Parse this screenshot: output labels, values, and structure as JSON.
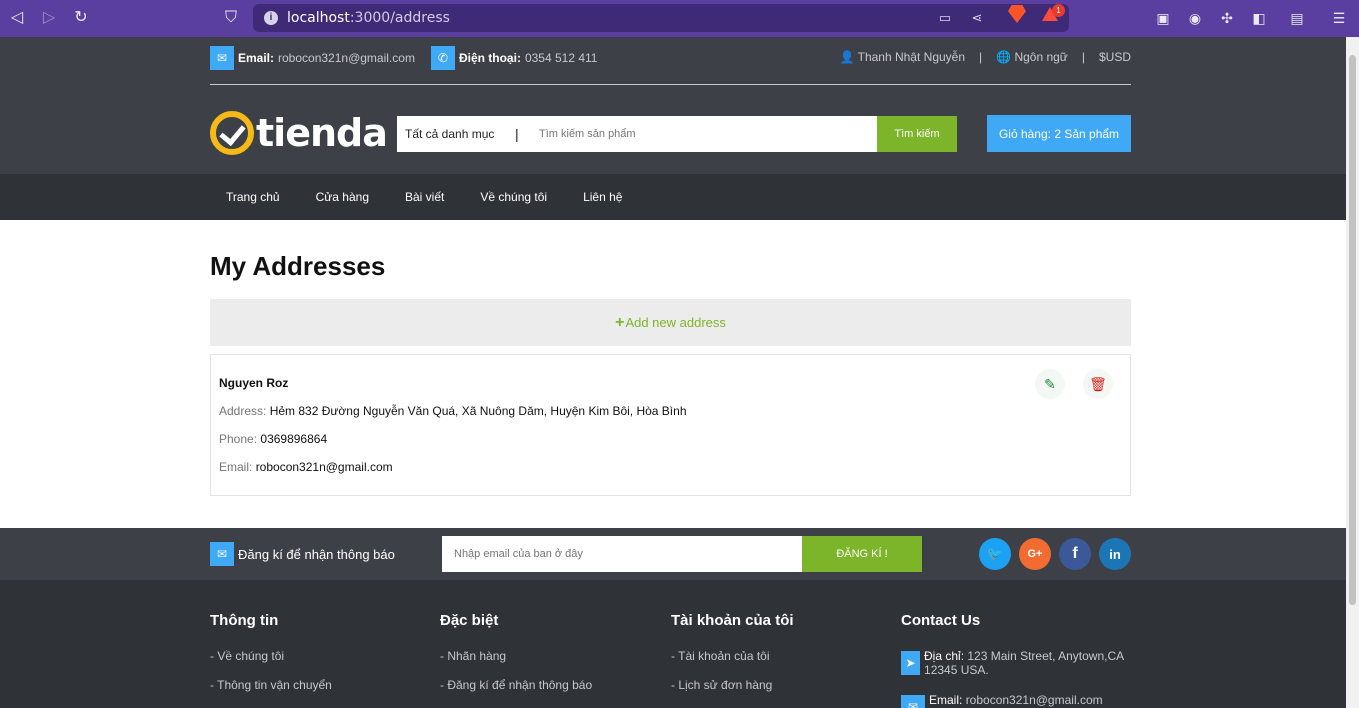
{
  "browser": {
    "url_host": "localhost",
    "url_path": ":3000/address",
    "rewards_badge": "1"
  },
  "topbar": {
    "email_label": "Email:",
    "email_value": "robocon321n@gmail.com",
    "phone_label": "Điện thoại:",
    "phone_value": "0354 512 411",
    "user_name": "Thanh Nhật Nguyễn",
    "language": "Ngôn ngữ",
    "currency": "USD",
    "separator": "|"
  },
  "logo": {
    "text": "tienda"
  },
  "search": {
    "category": "Tất cả danh mục",
    "divider": "|",
    "placeholder": "Tìm kiếm sản phẩm",
    "button": "Tìm kiếm"
  },
  "cart": {
    "label": "Giỏ hàng: 2 Sản phẩm"
  },
  "nav": {
    "items": [
      "Trang chủ",
      "Cửa hàng",
      "Bài viết",
      "Về chúng tôi",
      "Liên hệ"
    ]
  },
  "main": {
    "title": "My Addresses",
    "add_plus": "+",
    "add_label": "Add new address",
    "addresses": [
      {
        "name": "Nguyen Roz",
        "address_label": "Address:",
        "address": "Hẻm 832 Đường Nguyễn Văn Quá, Xã Nuông Dăm, Huyện Kim Bôi, Hòa Bình",
        "phone_label": "Phone:",
        "phone": "0369896864",
        "email_label": "Email:",
        "email": "robocon321n@gmail.com"
      }
    ]
  },
  "subscribe": {
    "label": "Đăng kí để nhận thông báo",
    "placeholder": "Nhập email của ban ở đây",
    "button": "ĐĂNG KÍ !",
    "social": {
      "gplus": "G+",
      "facebook": "f",
      "linkedin": "in"
    }
  },
  "footer": {
    "info": {
      "title": "Thông tin",
      "links": [
        "- Về chúng tôi",
        "- Thông tin vận chuyển"
      ]
    },
    "special": {
      "title": "Đặc biệt",
      "links": [
        "- Nhãn hàng",
        "- Đăng kí để nhận thông báo"
      ]
    },
    "account": {
      "title": "Tài khoản của tôi",
      "links": [
        "- Tài khoản của tôi",
        "- Lịch sử đơn hàng"
      ]
    },
    "contact": {
      "title": "Contact Us",
      "address_label": "Địa chỉ:",
      "address": "123 Main Street, Anytown,CA 12345 USA.",
      "email_label": "Email:",
      "email": "robocon321n@gmail.com"
    }
  },
  "colors": {
    "brand_green": "#7db52a",
    "brand_blue": "#3fa9f5",
    "header_dark": "#3d4147",
    "nav_dark": "#2f3236",
    "browser_purple": "#5b3fa0"
  }
}
